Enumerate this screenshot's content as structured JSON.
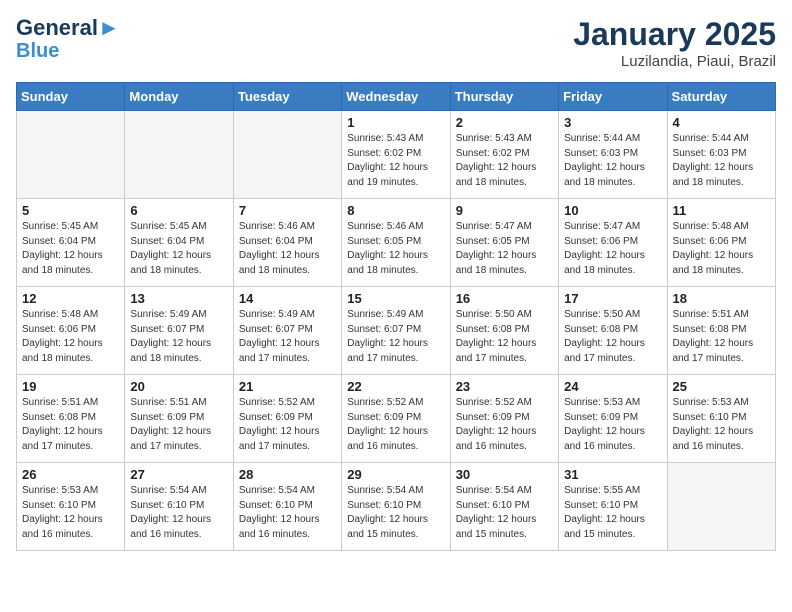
{
  "logo": {
    "line1": "General",
    "line2": "Blue"
  },
  "title": {
    "month_year": "January 2025",
    "location": "Luzilandia, Piaui, Brazil"
  },
  "headers": [
    "Sunday",
    "Monday",
    "Tuesday",
    "Wednesday",
    "Thursday",
    "Friday",
    "Saturday"
  ],
  "weeks": [
    [
      {
        "day": "",
        "info": ""
      },
      {
        "day": "",
        "info": ""
      },
      {
        "day": "",
        "info": ""
      },
      {
        "day": "1",
        "info": "Sunrise: 5:43 AM\nSunset: 6:02 PM\nDaylight: 12 hours\nand 19 minutes."
      },
      {
        "day": "2",
        "info": "Sunrise: 5:43 AM\nSunset: 6:02 PM\nDaylight: 12 hours\nand 18 minutes."
      },
      {
        "day": "3",
        "info": "Sunrise: 5:44 AM\nSunset: 6:03 PM\nDaylight: 12 hours\nand 18 minutes."
      },
      {
        "day": "4",
        "info": "Sunrise: 5:44 AM\nSunset: 6:03 PM\nDaylight: 12 hours\nand 18 minutes."
      }
    ],
    [
      {
        "day": "5",
        "info": "Sunrise: 5:45 AM\nSunset: 6:04 PM\nDaylight: 12 hours\nand 18 minutes."
      },
      {
        "day": "6",
        "info": "Sunrise: 5:45 AM\nSunset: 6:04 PM\nDaylight: 12 hours\nand 18 minutes."
      },
      {
        "day": "7",
        "info": "Sunrise: 5:46 AM\nSunset: 6:04 PM\nDaylight: 12 hours\nand 18 minutes."
      },
      {
        "day": "8",
        "info": "Sunrise: 5:46 AM\nSunset: 6:05 PM\nDaylight: 12 hours\nand 18 minutes."
      },
      {
        "day": "9",
        "info": "Sunrise: 5:47 AM\nSunset: 6:05 PM\nDaylight: 12 hours\nand 18 minutes."
      },
      {
        "day": "10",
        "info": "Sunrise: 5:47 AM\nSunset: 6:06 PM\nDaylight: 12 hours\nand 18 minutes."
      },
      {
        "day": "11",
        "info": "Sunrise: 5:48 AM\nSunset: 6:06 PM\nDaylight: 12 hours\nand 18 minutes."
      }
    ],
    [
      {
        "day": "12",
        "info": "Sunrise: 5:48 AM\nSunset: 6:06 PM\nDaylight: 12 hours\nand 18 minutes."
      },
      {
        "day": "13",
        "info": "Sunrise: 5:49 AM\nSunset: 6:07 PM\nDaylight: 12 hours\nand 18 minutes."
      },
      {
        "day": "14",
        "info": "Sunrise: 5:49 AM\nSunset: 6:07 PM\nDaylight: 12 hours\nand 17 minutes."
      },
      {
        "day": "15",
        "info": "Sunrise: 5:49 AM\nSunset: 6:07 PM\nDaylight: 12 hours\nand 17 minutes."
      },
      {
        "day": "16",
        "info": "Sunrise: 5:50 AM\nSunset: 6:08 PM\nDaylight: 12 hours\nand 17 minutes."
      },
      {
        "day": "17",
        "info": "Sunrise: 5:50 AM\nSunset: 6:08 PM\nDaylight: 12 hours\nand 17 minutes."
      },
      {
        "day": "18",
        "info": "Sunrise: 5:51 AM\nSunset: 6:08 PM\nDaylight: 12 hours\nand 17 minutes."
      }
    ],
    [
      {
        "day": "19",
        "info": "Sunrise: 5:51 AM\nSunset: 6:08 PM\nDaylight: 12 hours\nand 17 minutes."
      },
      {
        "day": "20",
        "info": "Sunrise: 5:51 AM\nSunset: 6:09 PM\nDaylight: 12 hours\nand 17 minutes."
      },
      {
        "day": "21",
        "info": "Sunrise: 5:52 AM\nSunset: 6:09 PM\nDaylight: 12 hours\nand 17 minutes."
      },
      {
        "day": "22",
        "info": "Sunrise: 5:52 AM\nSunset: 6:09 PM\nDaylight: 12 hours\nand 16 minutes."
      },
      {
        "day": "23",
        "info": "Sunrise: 5:52 AM\nSunset: 6:09 PM\nDaylight: 12 hours\nand 16 minutes."
      },
      {
        "day": "24",
        "info": "Sunrise: 5:53 AM\nSunset: 6:09 PM\nDaylight: 12 hours\nand 16 minutes."
      },
      {
        "day": "25",
        "info": "Sunrise: 5:53 AM\nSunset: 6:10 PM\nDaylight: 12 hours\nand 16 minutes."
      }
    ],
    [
      {
        "day": "26",
        "info": "Sunrise: 5:53 AM\nSunset: 6:10 PM\nDaylight: 12 hours\nand 16 minutes."
      },
      {
        "day": "27",
        "info": "Sunrise: 5:54 AM\nSunset: 6:10 PM\nDaylight: 12 hours\nand 16 minutes."
      },
      {
        "day": "28",
        "info": "Sunrise: 5:54 AM\nSunset: 6:10 PM\nDaylight: 12 hours\nand 16 minutes."
      },
      {
        "day": "29",
        "info": "Sunrise: 5:54 AM\nSunset: 6:10 PM\nDaylight: 12 hours\nand 15 minutes."
      },
      {
        "day": "30",
        "info": "Sunrise: 5:54 AM\nSunset: 6:10 PM\nDaylight: 12 hours\nand 15 minutes."
      },
      {
        "day": "31",
        "info": "Sunrise: 5:55 AM\nSunset: 6:10 PM\nDaylight: 12 hours\nand 15 minutes."
      },
      {
        "day": "",
        "info": ""
      }
    ]
  ]
}
